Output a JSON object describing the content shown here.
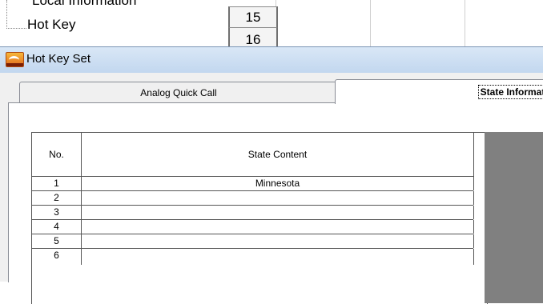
{
  "background": {
    "tree": {
      "partial_item_label": "Local Information",
      "item_label": "Hot Key"
    },
    "grid_row_numbers": [
      "15",
      "16"
    ]
  },
  "dialog": {
    "title": "Hot Key Set",
    "icon": "app-logo-icon",
    "tabs": [
      {
        "label": "Analog Quick Call",
        "active": false
      },
      {
        "label": "State Information",
        "active": true
      }
    ],
    "table": {
      "columns": [
        "No.",
        "State Content"
      ],
      "rows": [
        {
          "no": "1",
          "content": "Minnesota"
        },
        {
          "no": "2",
          "content": ""
        },
        {
          "no": "3",
          "content": ""
        },
        {
          "no": "4",
          "content": ""
        },
        {
          "no": "5",
          "content": ""
        },
        {
          "no": "6",
          "content": ""
        }
      ]
    }
  },
  "colors": {
    "titlebar": "#c9dcf1",
    "grid_gray_area": "#808080"
  }
}
